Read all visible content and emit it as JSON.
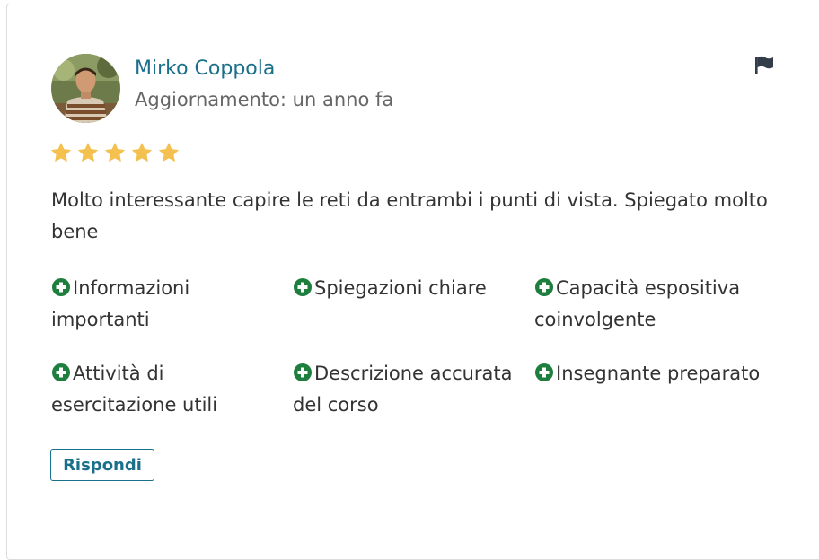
{
  "reviewer": {
    "name": "Mirko Coppola",
    "updated": "Aggiornamento: un anno fa"
  },
  "rating": {
    "stars": 5,
    "max": 5,
    "color": "#f4c150"
  },
  "review": {
    "text": "Molto interessante capire le reti da entrambi i punti di vista. Spiegato molto bene"
  },
  "tags": [
    "Informazioni importanti",
    "Spiegazioni chiare",
    "Capacità espositiva coinvolgente",
    "Attività di esercitazione utili",
    "Descrizione accurata del corso",
    "Insegnante preparato"
  ],
  "actions": {
    "reply_label": "Rispondi",
    "flag_icon": "flag-icon"
  },
  "colors": {
    "accent": "#1a6f8a",
    "tag_icon": "#1e7e3e",
    "text": "#333333",
    "muted": "#666666"
  }
}
